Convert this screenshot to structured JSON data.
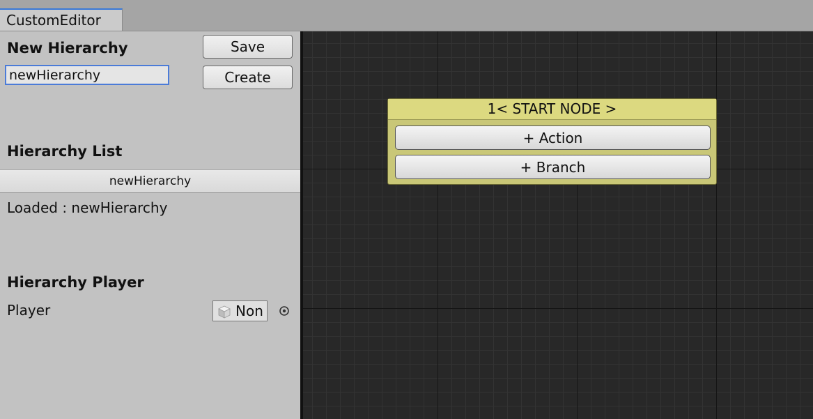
{
  "window": {
    "tab_title": "CustomEditor"
  },
  "new_hierarchy": {
    "heading": "New Hierarchy",
    "name_value": "newHierarchy",
    "save_label": "Save",
    "create_label": "Create"
  },
  "hierarchy_list": {
    "heading": "Hierarchy List",
    "items": [
      "newHierarchy"
    ],
    "loaded_status": "Loaded : newHierarchy"
  },
  "hierarchy_player": {
    "heading": "Hierarchy Player",
    "player_label": "Player",
    "player_value": "Non",
    "object_icon": "cube-icon",
    "picker_icon": "object-picker-icon"
  },
  "graph": {
    "start_node": {
      "title": "1< START NODE >",
      "action_label": "+ Action",
      "branch_label": "+ Branch",
      "color": "#c9c777"
    }
  }
}
